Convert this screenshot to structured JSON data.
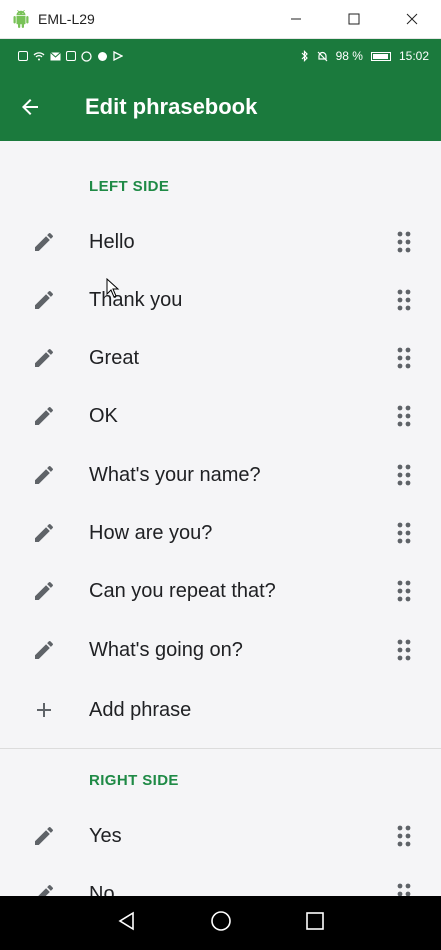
{
  "window": {
    "title": "EML-L29"
  },
  "statusbar": {
    "battery": "98 %",
    "time": "15:02"
  },
  "appbar": {
    "title": "Edit phrasebook"
  },
  "left_side": {
    "title": "LEFT SIDE",
    "phrases": [
      "Hello",
      "Thank you",
      "Great",
      "OK",
      "What's your name?",
      "How are you?",
      "Can you repeat that?",
      "What's going on?"
    ],
    "add_label": "Add phrase"
  },
  "right_side": {
    "title": "RIGHT SIDE",
    "phrases": [
      "Yes",
      "No"
    ]
  },
  "colors": {
    "accent": "#1b7a3d",
    "section": "#1f8a46",
    "icon": "#5f6368"
  }
}
